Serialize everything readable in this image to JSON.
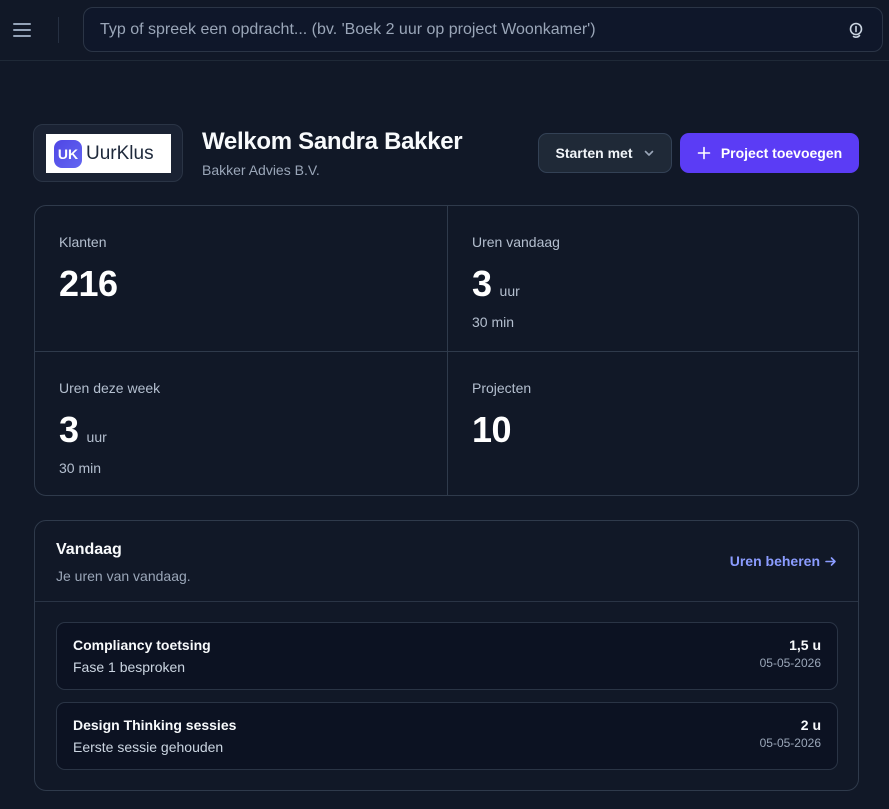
{
  "topbar": {
    "command_placeholder": "Typ of spreek een opdracht... (bv. 'Boek 2 uur op project Woonkamer')"
  },
  "header": {
    "logo_mark": "UK",
    "logo_text": "UurKlus",
    "welcome": "Welkom Sandra Bakker",
    "company": "Bakker Advies B.V.",
    "start_button": "Starten met",
    "add_button": "Project toevoegen"
  },
  "stats": [
    {
      "label": "Klanten",
      "value": "216",
      "unit": "",
      "sub": ""
    },
    {
      "label": "Uren vandaag",
      "value": "3",
      "unit": "uur",
      "sub": "30 min"
    },
    {
      "label": "Uren deze week",
      "value": "3",
      "unit": "uur",
      "sub": "30 min"
    },
    {
      "label": "Projecten",
      "value": "10",
      "unit": "",
      "sub": ""
    }
  ],
  "today": {
    "title": "Vandaag",
    "subtitle": "Je uren van vandaag.",
    "manage_link": "Uren beheren",
    "entries": [
      {
        "name": "Compliancy toetsing",
        "note": "Fase 1 besproken",
        "hours": "1,5 u",
        "date": "05-05-2026"
      },
      {
        "name": "Design Thinking sessies",
        "note": "Eerste sessie gehouden",
        "hours": "2 u",
        "date": "05-05-2026"
      }
    ]
  },
  "colors": {
    "background": "#111827",
    "accent": "#5b3cf5",
    "link": "#8b9cff"
  },
  "icons": [
    "menu-icon",
    "microphone-icon",
    "chevron-down-icon",
    "plus-icon",
    "arrow-right-icon"
  ]
}
